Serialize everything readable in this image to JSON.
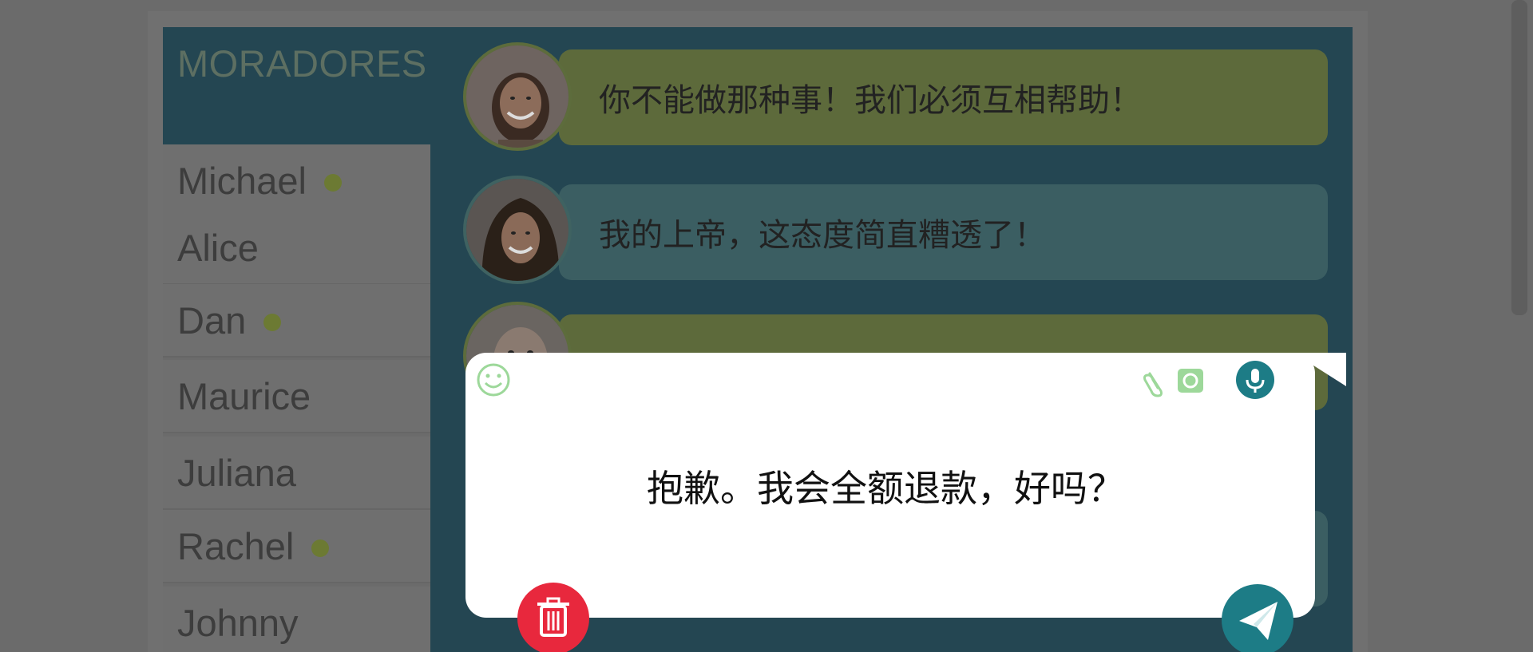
{
  "sidebar": {
    "title": "MORADORES",
    "residents": [
      {
        "name": "Michael",
        "online": true
      },
      {
        "name": "Alice",
        "online": false
      },
      {
        "name": "Dan",
        "online": true
      },
      {
        "name": "Maurice",
        "online": false
      },
      {
        "name": "Juliana",
        "online": false
      },
      {
        "name": "Rachel",
        "online": true
      },
      {
        "name": "Johnny",
        "online": false
      }
    ]
  },
  "messages": [
    {
      "text": "你不能做那种事！我们必须互相帮助！",
      "avatar": "woman-smiling-avatar",
      "color": "#5d6a3b"
    },
    {
      "text": "我的上帝，这态度简直糟透了！",
      "avatar": "woman-long-hair-avatar",
      "color": "#3b5e62"
    },
    {
      "text": "",
      "avatar": "bald-man-avatar",
      "color": "#5d6a3b"
    }
  ],
  "compose": {
    "draft_text": "抱歉。我会全额退款，好吗？",
    "icons": {
      "emoji": "smiley-icon",
      "attach": "paperclip-icon",
      "camera": "camera-icon",
      "mic": "microphone-icon",
      "delete": "trash-icon",
      "send": "send-icon"
    }
  },
  "colors": {
    "app_bg": "#244652",
    "bubble_green": "#5d6a3b",
    "bubble_teal": "#3b5e62",
    "online_dot": "#6c7a33",
    "mic_send": "#1d7c86",
    "trash": "#e8283d",
    "camera": "#9dd89a"
  }
}
